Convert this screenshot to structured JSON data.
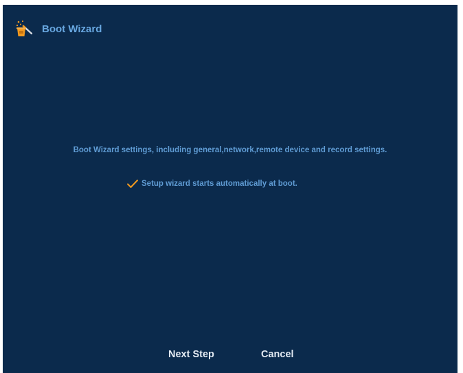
{
  "window": {
    "title": "Boot Wizard",
    "title_icon": "magic-wand-icon"
  },
  "main": {
    "description": "Boot Wizard settings, including general,network,remote device and record settings.",
    "auto_start": {
      "label": "Setup wizard starts automatically at boot.",
      "checked": true,
      "icon": "checkmark-icon"
    }
  },
  "footer": {
    "next_label": "Next Step",
    "cancel_label": "Cancel"
  },
  "colors": {
    "background": "#0b2a4c",
    "title_text": "#68a7e0",
    "body_text": "#5f9bd3",
    "accent": "#f29a1f",
    "button_text": "#e4ebf3"
  }
}
